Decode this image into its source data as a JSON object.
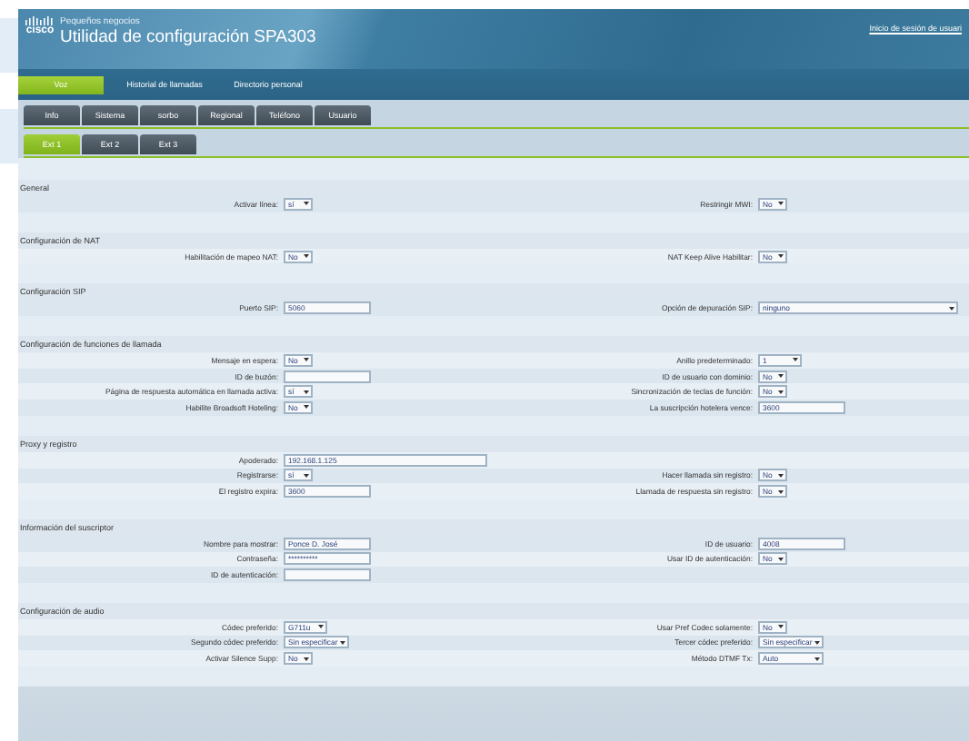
{
  "header": {
    "brand": "cisco",
    "subtitle": "Pequeños negocios",
    "title": "Utilidad de configuración SPA303",
    "login_link": "Inicio de sesión de usuari"
  },
  "nav": [
    {
      "label": "Voz",
      "selected": true
    },
    {
      "label": "Historial de llamadas",
      "selected": false
    },
    {
      "label": "Directorio personal",
      "selected": false
    }
  ],
  "tabs": [
    {
      "label": "Info",
      "selected": false
    },
    {
      "label": "Sistema",
      "selected": false
    },
    {
      "label": "sorbo",
      "selected": false
    },
    {
      "label": "Regional",
      "selected": false
    },
    {
      "label": "Teléfono",
      "selected": false
    },
    {
      "label": "Usuario",
      "selected": false
    }
  ],
  "subtabs": [
    {
      "label": "Ext 1",
      "selected": true
    },
    {
      "label": "Ext 2",
      "selected": false
    },
    {
      "label": "Ext 3",
      "selected": false
    }
  ],
  "sections": [
    {
      "title": "General",
      "rows": [
        {
          "left": {
            "label": "Activar línea:",
            "kind": "select",
            "value": "sí"
          },
          "right": {
            "label": "Restringir MWI:",
            "kind": "select",
            "value": "No"
          }
        }
      ]
    },
    {
      "title": "Configuración de NAT",
      "rows": [
        {
          "left": {
            "label": "Habilitación de mapeo NAT:",
            "kind": "select",
            "value": "No"
          },
          "right": {
            "label": "NAT Keep Alive Habilitar:",
            "kind": "select",
            "value": "No"
          }
        }
      ]
    },
    {
      "title": "Configuración SIP",
      "rows": [
        {
          "left": {
            "label": "Puerto SIP:",
            "kind": "text",
            "value": "5060"
          },
          "right": {
            "label": "Opción de depuración SIP:",
            "kind": "select-wide",
            "value": "ninguno"
          }
        }
      ]
    },
    {
      "title": "Configuración de funciones de llamada",
      "rows": [
        {
          "left": {
            "label": "Mensaje en espera:",
            "kind": "select",
            "value": "No"
          },
          "right": {
            "label": "Anillo predeterminado:",
            "kind": "select-mid",
            "value": "1"
          }
        },
        {
          "left": {
            "label": "ID de buzón:",
            "kind": "text"
          },
          "right": {
            "label": "ID de usuario con dominio:",
            "kind": "select",
            "value": "No"
          }
        },
        {
          "left": {
            "label": "Página de respuesta automática en llamada activa:",
            "kind": "select",
            "value": "sí"
          },
          "right": {
            "label": "Sincronización de teclas de función:",
            "kind": "select",
            "value": "No"
          }
        },
        {
          "left": {
            "label": "Habilite Broadsoft Hoteling:",
            "kind": "select",
            "value": "No"
          },
          "right": {
            "label": "La suscripción hotelera vence:",
            "kind": "text",
            "value": "3600"
          }
        }
      ]
    },
    {
      "title": "Proxy y registro",
      "rows": [
        {
          "left": {
            "label": "Apoderado:",
            "kind": "text-wide",
            "value": "192.168.1.125"
          }
        },
        {
          "left": {
            "label": "Registrarse:",
            "kind": "select",
            "value": "sí"
          },
          "right": {
            "label": "Hacer llamada sin registro:",
            "kind": "select",
            "value": "No"
          }
        },
        {
          "left": {
            "label": "El registro expira:",
            "kind": "text",
            "value": "3600"
          },
          "right": {
            "label": "Llamada de respuesta sin registro:",
            "kind": "select",
            "value": "No"
          }
        }
      ]
    },
    {
      "title": "Información del suscriptor",
      "rows": [
        {
          "left": {
            "label": "Nombre para mostrar:",
            "kind": "text",
            "value": "Ponce D. José"
          },
          "right": {
            "label": "ID de usuario:",
            "kind": "text",
            "value": "4008"
          }
        },
        {
          "left": {
            "label": "Contraseña:",
            "kind": "text",
            "value": "**********"
          },
          "right": {
            "label": "Usar ID de autenticación:",
            "kind": "select",
            "value": "No"
          }
        },
        {
          "left": {
            "label": "ID de autenticación:",
            "kind": "text"
          }
        }
      ]
    },
    {
      "title": "Configuración de audio",
      "rows": [
        {
          "left": {
            "label": "Códec preferido:",
            "kind": "select-mid",
            "value": "G711u"
          },
          "right": {
            "label": "Usar Pref Codec solamente:",
            "kind": "select",
            "value": "No"
          }
        },
        {
          "left": {
            "label": "Segundo códec preferido:",
            "kind": "select-long",
            "value": "Sin especificar"
          },
          "right": {
            "label": "Tercer códec preferido:",
            "kind": "select-long",
            "value": "Sin especificar"
          }
        },
        {
          "left": {
            "label": "Activar Silence Supp:",
            "kind": "select",
            "value": "No"
          },
          "right": {
            "label": "Método DTMF Tx:",
            "kind": "select-long",
            "value": "Auto"
          }
        }
      ]
    }
  ]
}
